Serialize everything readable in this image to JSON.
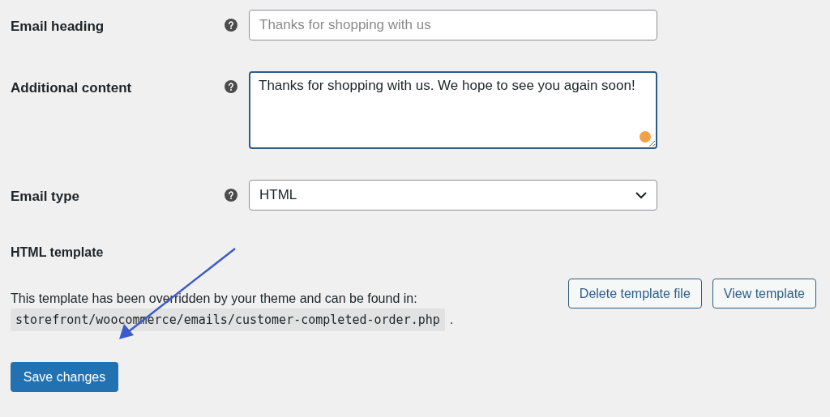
{
  "fields": [
    {
      "kind": "text",
      "label": "Email heading",
      "placeholder": "Thanks for shopping with us"
    },
    {
      "kind": "textarea",
      "label": "Additional content",
      "value": "Thanks for shopping with us. We hope to see you again soon!"
    },
    {
      "kind": "select",
      "label": "Email type",
      "value": "HTML"
    }
  ],
  "template": {
    "label": "HTML template",
    "description": "This template has been overridden by your theme and can be found in:",
    "path": "storefront/woocommerce/emails/customer-completed-order.php",
    "path_suffix": ".",
    "buttons": [
      "Delete template file",
      "View template"
    ]
  },
  "save_button": "Save changes"
}
